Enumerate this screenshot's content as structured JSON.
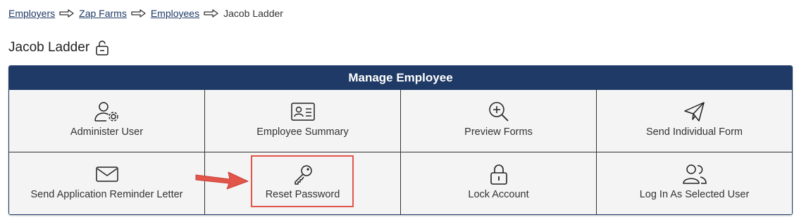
{
  "breadcrumb": {
    "items": [
      "Employers",
      "Zap Farms",
      "Employees"
    ],
    "current": "Jacob Ladder"
  },
  "page": {
    "title": "Jacob Ladder",
    "lock_icon": "unlock-icon"
  },
  "panel": {
    "header": "Manage Employee",
    "tiles": [
      {
        "label": "Administer User",
        "icon": "user-gear-icon"
      },
      {
        "label": "Employee Summary",
        "icon": "id-card-icon"
      },
      {
        "label": "Preview Forms",
        "icon": "zoom-in-icon"
      },
      {
        "label": "Send Individual Form",
        "icon": "paper-plane-icon"
      },
      {
        "label": "Send Application Reminder Letter",
        "icon": "envelope-icon"
      },
      {
        "label": "Reset Password",
        "icon": "key-icon"
      },
      {
        "label": "Lock Account",
        "icon": "lock-icon"
      },
      {
        "label": "Log In As Selected User",
        "icon": "users-icon"
      }
    ]
  },
  "colors": {
    "header_bg": "#1f3a66",
    "link": "#1f3a66",
    "annotation": "#e2554a"
  }
}
